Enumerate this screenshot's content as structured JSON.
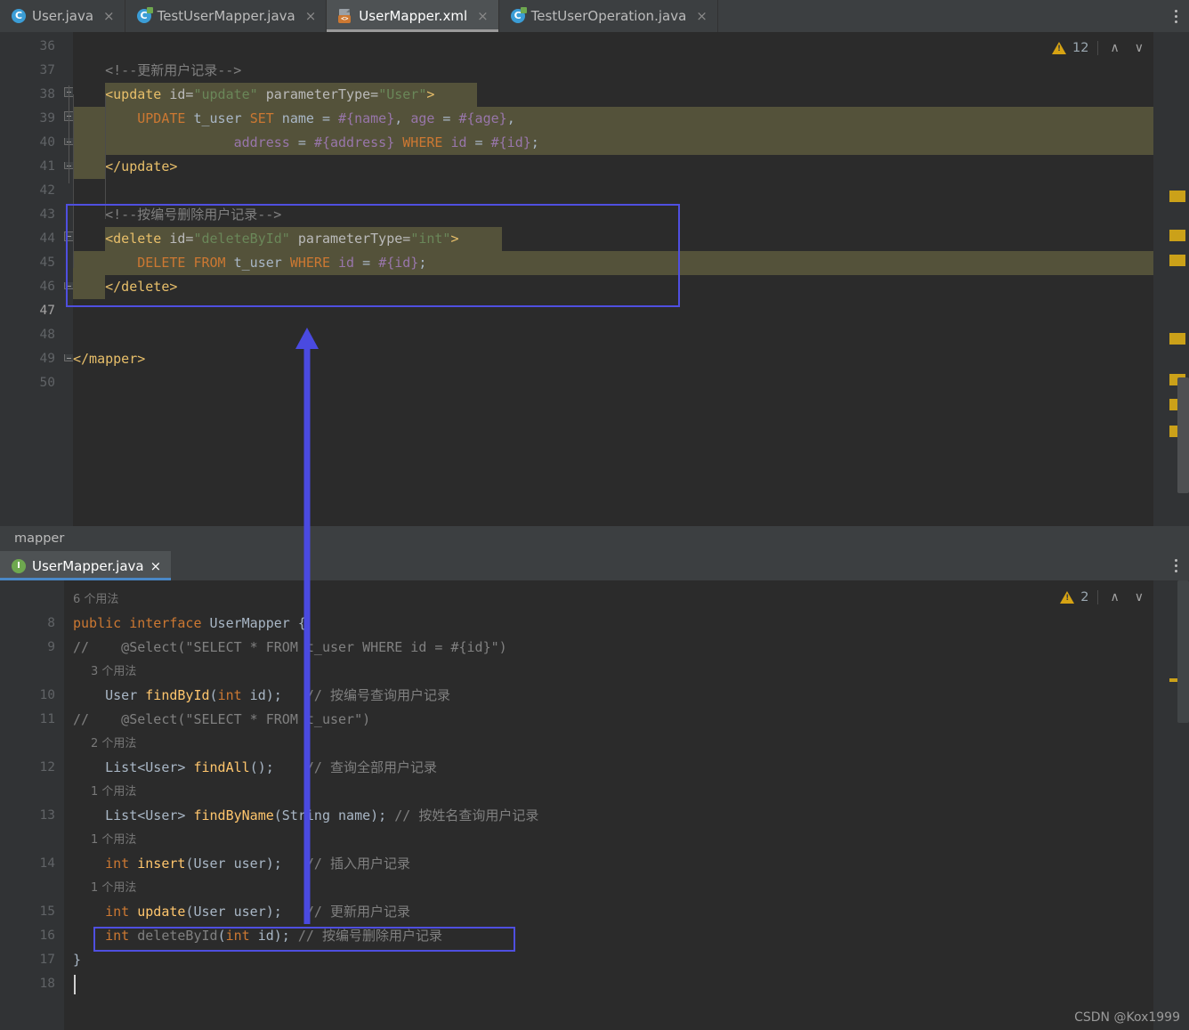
{
  "window": {
    "watermark": "CSDN @Kox1999"
  },
  "top_tabbar": {
    "tabs": [
      {
        "label": "User.java",
        "icon": "java-class-icon",
        "active": false,
        "closable": true
      },
      {
        "label": "TestUserMapper.java",
        "icon": "java-test-class-icon",
        "active": false,
        "closable": true
      },
      {
        "label": "UserMapper.xml",
        "icon": "xml-file-icon",
        "active": true,
        "closable": true
      },
      {
        "label": "TestUserOperation.java",
        "icon": "java-test-class-icon",
        "active": false,
        "closable": true
      }
    ],
    "overflow_menu": "tab-options-icon"
  },
  "top_editor": {
    "file": "UserMapper.xml",
    "inspection": {
      "icon": "warning-icon",
      "count": "12",
      "prev": "∧",
      "next": "∨"
    },
    "current_line": 47,
    "lines": [
      {
        "num": "36",
        "text": "",
        "tokens": []
      },
      {
        "num": "37",
        "text": "    <!--更新用户记录-->",
        "tokens": [
          {
            "t": "    ",
            "c": "t-txt"
          },
          {
            "t": "<!--更新用户记录-->",
            "c": "t-cmt"
          }
        ]
      },
      {
        "num": "38",
        "text": "    <update id=\"update\" parameterType=\"User\">",
        "tokens": [
          {
            "t": "    ",
            "c": "t-txt"
          },
          {
            "t": "<update",
            "c": "t-tag"
          },
          {
            "t": " id=",
            "c": "t-attr"
          },
          {
            "t": "\"update\"",
            "c": "t-val"
          },
          {
            "t": " parameterType=",
            "c": "t-attr"
          },
          {
            "t": "\"User\"",
            "c": "t-val"
          },
          {
            "t": ">",
            "c": "t-tag"
          }
        ]
      },
      {
        "num": "39",
        "text": "        UPDATE t_user SET name = #{name}, age = #{age},",
        "tokens": [
          {
            "t": "        ",
            "c": "t-txt"
          },
          {
            "t": "UPDATE",
            "c": "t-kw"
          },
          {
            "t": " t_user ",
            "c": "t-txt"
          },
          {
            "t": "SET",
            "c": "t-kw"
          },
          {
            "t": " name = ",
            "c": "t-txt"
          },
          {
            "t": "#{name}",
            "c": "t-par"
          },
          {
            "t": ", ",
            "c": "t-txt"
          },
          {
            "t": "age",
            "c": "t-par"
          },
          {
            "t": " = ",
            "c": "t-txt"
          },
          {
            "t": "#{age}",
            "c": "t-par"
          },
          {
            "t": ",",
            "c": "t-txt"
          }
        ]
      },
      {
        "num": "40",
        "text": "                    address = #{address} WHERE id = #{id};",
        "tokens": [
          {
            "t": "                    ",
            "c": "t-txt"
          },
          {
            "t": "address",
            "c": "t-par"
          },
          {
            "t": " = ",
            "c": "t-txt"
          },
          {
            "t": "#{address}",
            "c": "t-par"
          },
          {
            "t": " ",
            "c": "t-txt"
          },
          {
            "t": "WHERE",
            "c": "t-kw"
          },
          {
            "t": " ",
            "c": "t-txt"
          },
          {
            "t": "id",
            "c": "t-par"
          },
          {
            "t": " = ",
            "c": "t-txt"
          },
          {
            "t": "#{id}",
            "c": "t-par"
          },
          {
            "t": ";",
            "c": "t-txt"
          }
        ]
      },
      {
        "num": "41",
        "text": "    </update>",
        "tokens": [
          {
            "t": "    ",
            "c": "t-txt"
          },
          {
            "t": "</update>",
            "c": "t-tag"
          }
        ]
      },
      {
        "num": "42",
        "text": "",
        "tokens": []
      },
      {
        "num": "43",
        "text": "    <!--按编号删除用户记录-->",
        "tokens": [
          {
            "t": "    ",
            "c": "t-txt"
          },
          {
            "t": "<!--按编号删除用户记录-->",
            "c": "t-cmt"
          }
        ]
      },
      {
        "num": "44",
        "text": "    <delete id=\"deleteById\" parameterType=\"int\">",
        "tokens": [
          {
            "t": "    ",
            "c": "t-txt"
          },
          {
            "t": "<delete",
            "c": "t-tag"
          },
          {
            "t": " id=",
            "c": "t-attr"
          },
          {
            "t": "\"deleteById\"",
            "c": "t-val"
          },
          {
            "t": " parameterType=",
            "c": "t-attr"
          },
          {
            "t": "\"int\"",
            "c": "t-val"
          },
          {
            "t": ">",
            "c": "t-tag"
          }
        ]
      },
      {
        "num": "45",
        "text": "        DELETE FROM t_user WHERE id = #{id};",
        "tokens": [
          {
            "t": "        ",
            "c": "t-txt"
          },
          {
            "t": "DELETE",
            "c": "t-kw"
          },
          {
            "t": " ",
            "c": "t-txt"
          },
          {
            "t": "FROM",
            "c": "t-kw"
          },
          {
            "t": " t_user ",
            "c": "t-txt"
          },
          {
            "t": "WHERE",
            "c": "t-kw"
          },
          {
            "t": " ",
            "c": "t-txt"
          },
          {
            "t": "id",
            "c": "t-par"
          },
          {
            "t": " = ",
            "c": "t-txt"
          },
          {
            "t": "#{id}",
            "c": "t-par"
          },
          {
            "t": ";",
            "c": "t-txt"
          }
        ]
      },
      {
        "num": "46",
        "text": "    </delete>",
        "tokens": [
          {
            "t": "    ",
            "c": "t-txt"
          },
          {
            "t": "</delete>",
            "c": "t-tag"
          }
        ]
      },
      {
        "num": "47",
        "text": "",
        "tokens": []
      },
      {
        "num": "48",
        "text": "",
        "tokens": []
      },
      {
        "num": "49",
        "text": "</mapper>",
        "tokens": [
          {
            "t": "</mapper>",
            "c": "t-tag"
          }
        ]
      },
      {
        "num": "50",
        "text": "",
        "tokens": []
      }
    ]
  },
  "breadcrumb": {
    "label": "mapper"
  },
  "bottom_tabbar": {
    "tabs": [
      {
        "label": "UserMapper.java",
        "icon": "java-interface-icon",
        "active": true,
        "closable": true
      }
    ],
    "overflow_menu": "tab-options-icon"
  },
  "bottom_editor": {
    "file": "UserMapper.java",
    "inspection": {
      "icon": "warning-icon",
      "count": "2",
      "prev": "∧",
      "next": "∨"
    },
    "lines": [
      {
        "kind": "hint",
        "text": "6 个用法",
        "indent": 0
      },
      {
        "kind": "code",
        "num": "8",
        "text": "public interface UserMapper {",
        "tokens": [
          {
            "t": "public",
            "c": "t-kw"
          },
          {
            "t": " ",
            "c": "t-txt"
          },
          {
            "t": "interface",
            "c": "t-kw"
          },
          {
            "t": " UserMapper ",
            "c": "t-txt"
          },
          {
            "t": "{",
            "c": "t-txt"
          }
        ]
      },
      {
        "kind": "code",
        "num": "9",
        "text": "//    @Select(\"SELECT * FROM t_user WHERE id = #{id}\")",
        "tokens": [
          {
            "t": "//    @Select(\"SELECT * FROM t_user WHERE id = #{id}\")",
            "c": "t-cmt"
          }
        ]
      },
      {
        "kind": "hint",
        "text": "3 个用法",
        "indent": 1
      },
      {
        "kind": "code",
        "num": "10",
        "text": "    User findById(int id);   // 按编号查询用户记录",
        "tokens": [
          {
            "t": "    User ",
            "c": "t-txt"
          },
          {
            "t": "findById",
            "c": "t-meth"
          },
          {
            "t": "(",
            "c": "t-txt"
          },
          {
            "t": "int",
            "c": "t-kw"
          },
          {
            "t": " id)",
            "c": "t-txt"
          },
          {
            "t": ";",
            "c": "t-txt"
          },
          {
            "t": "   // 按编号查询用户记录",
            "c": "t-cmt"
          }
        ]
      },
      {
        "kind": "code",
        "num": "11",
        "text": "//    @Select(\"SELECT * FROM t_user\")",
        "tokens": [
          {
            "t": "//    @Select(\"SELECT * FROM t_user\")",
            "c": "t-cmt"
          }
        ]
      },
      {
        "kind": "hint",
        "text": "2 个用法",
        "indent": 1
      },
      {
        "kind": "code",
        "num": "12",
        "text": "    List<User> findAll();    // 查询全部用户记录",
        "tokens": [
          {
            "t": "    List<User> ",
            "c": "t-txt"
          },
          {
            "t": "findAll",
            "c": "t-meth"
          },
          {
            "t": "();",
            "c": "t-txt"
          },
          {
            "t": "    // 查询全部用户记录",
            "c": "t-cmt"
          }
        ]
      },
      {
        "kind": "hint",
        "text": "1 个用法",
        "indent": 1
      },
      {
        "kind": "code",
        "num": "13",
        "text": "    List<User> findByName(String name); // 按姓名查询用户记录",
        "tokens": [
          {
            "t": "    List<User> ",
            "c": "t-txt"
          },
          {
            "t": "findByName",
            "c": "t-meth"
          },
          {
            "t": "(String name);",
            "c": "t-txt"
          },
          {
            "t": " // 按姓名查询用户记录",
            "c": "t-cmt"
          }
        ]
      },
      {
        "kind": "hint",
        "text": "1 个用法",
        "indent": 1
      },
      {
        "kind": "code",
        "num": "14",
        "text": "    int insert(User user);   // 插入用户记录",
        "tokens": [
          {
            "t": "    ",
            "c": "t-txt"
          },
          {
            "t": "int",
            "c": "t-kw"
          },
          {
            "t": " ",
            "c": "t-txt"
          },
          {
            "t": "insert",
            "c": "t-meth"
          },
          {
            "t": "(User user);",
            "c": "t-txt"
          },
          {
            "t": "   // 插入用户记录",
            "c": "t-cmt"
          }
        ]
      },
      {
        "kind": "hint",
        "text": "1 个用法",
        "indent": 1
      },
      {
        "kind": "code",
        "num": "15",
        "text": "    int update(User user);   // 更新用户记录",
        "tokens": [
          {
            "t": "    ",
            "c": "t-txt"
          },
          {
            "t": "int",
            "c": "t-kw"
          },
          {
            "t": " ",
            "c": "t-txt"
          },
          {
            "t": "update",
            "c": "t-meth"
          },
          {
            "t": "(User user);",
            "c": "t-txt"
          },
          {
            "t": "   // 更新用户记录",
            "c": "t-cmt"
          }
        ]
      },
      {
        "kind": "code",
        "num": "16",
        "text": "    int deleteById(int id); // 按编号删除用户记录",
        "tokens": [
          {
            "t": "    ",
            "c": "t-txt"
          },
          {
            "t": "int",
            "c": "t-kw"
          },
          {
            "t": " ",
            "c": "t-txt"
          },
          {
            "t": "deleteById",
            "c": "t-gray"
          },
          {
            "t": "(",
            "c": "t-txt"
          },
          {
            "t": "int",
            "c": "t-kw"
          },
          {
            "t": " id);",
            "c": "t-txt"
          },
          {
            "t": " // 按编号删除用户记录",
            "c": "t-cmt"
          }
        ]
      },
      {
        "kind": "code",
        "num": "17",
        "text": "}",
        "tokens": [
          {
            "t": "}",
            "c": "t-txt"
          }
        ]
      },
      {
        "kind": "code",
        "num": "18",
        "text": "",
        "tokens": []
      }
    ]
  },
  "annotations": {
    "rect_xml_delete_block": {
      "label": "delete-block-highlight",
      "color": "#4f4fe0"
    },
    "rect_java_deletebyid": {
      "label": "deletebyid-method-highlight",
      "color": "#4f4fe0"
    },
    "arrow_up": {
      "label": "connector-arrow",
      "color": "#4a4ae0"
    }
  },
  "colors": {
    "editor_bg": "#2b2b2b",
    "gutter_bg": "#313335",
    "chrome_bg": "#3c3f41",
    "tab_active_bg": "#4e5254",
    "selection_bg": "#54523a",
    "accent_blue": "#4f4fe0",
    "warning": "#d6a313",
    "keyword": "#cc7832",
    "string": "#6a8759",
    "tag": "#e8bf6a",
    "param": "#9876aa",
    "method": "#ffc66d",
    "comment": "#808080",
    "text": "#a9b7c6"
  }
}
